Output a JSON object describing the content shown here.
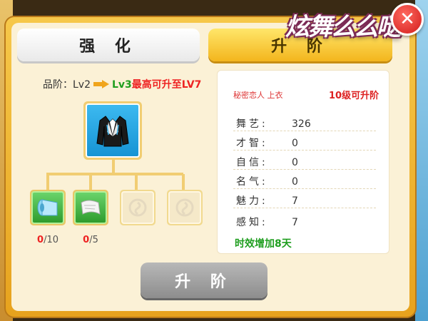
{
  "logo": {
    "text": "炫舞么么哒"
  },
  "tabs": [
    {
      "label": "强 化"
    },
    {
      "label": "升 阶"
    }
  ],
  "grade": {
    "prefix": "品阶：",
    "current": "Lv2",
    "next": "Lv3",
    "max_text": "最高可升至LV7"
  },
  "materials": [
    {
      "have": "0",
      "need": "/10"
    },
    {
      "have": "0",
      "need": "/5"
    }
  ],
  "stats_panel": {
    "item_name": "秘密恋人 上衣",
    "upgrade_hint": "10级可升阶",
    "stats": [
      {
        "label": "舞艺:",
        "value": "326"
      },
      {
        "label": "才智:",
        "value": "0"
      },
      {
        "label": "自信:",
        "value": "0"
      },
      {
        "label": "名气:",
        "value": "0"
      },
      {
        "label": "魅力:",
        "value": "7"
      },
      {
        "label": "感知:",
        "value": "7"
      }
    ],
    "bonus": "时效增加8天"
  },
  "advance_button": {
    "label": "升 阶"
  },
  "colors": {
    "accent": "#f3b51d",
    "green": "#1f9e1f",
    "red": "#e22222"
  },
  "icons": [
    "close-icon",
    "jacket-icon",
    "fabric-roll-icon",
    "pattern-paper-icon",
    "locked-slot-icon"
  ]
}
